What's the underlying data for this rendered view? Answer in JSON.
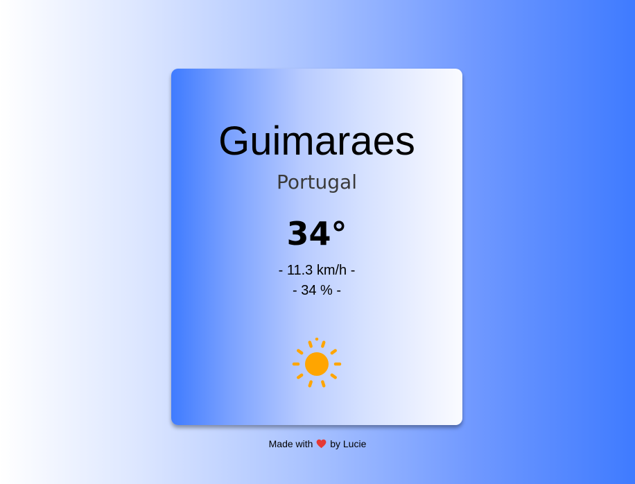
{
  "weather": {
    "city": "Guimaraes",
    "country": "Portugal",
    "temperature": "34°",
    "wind": "- 11.3 km/h -",
    "humidity": "- 34 % -",
    "condition_icon": "sun-icon"
  },
  "footer": {
    "prefix": "Made with",
    "icon": "heart-icon",
    "suffix": "by Lucie"
  },
  "colors": {
    "accent_blue": "#3f7bff",
    "sun": "#ffa500",
    "heart": "#e53935"
  }
}
